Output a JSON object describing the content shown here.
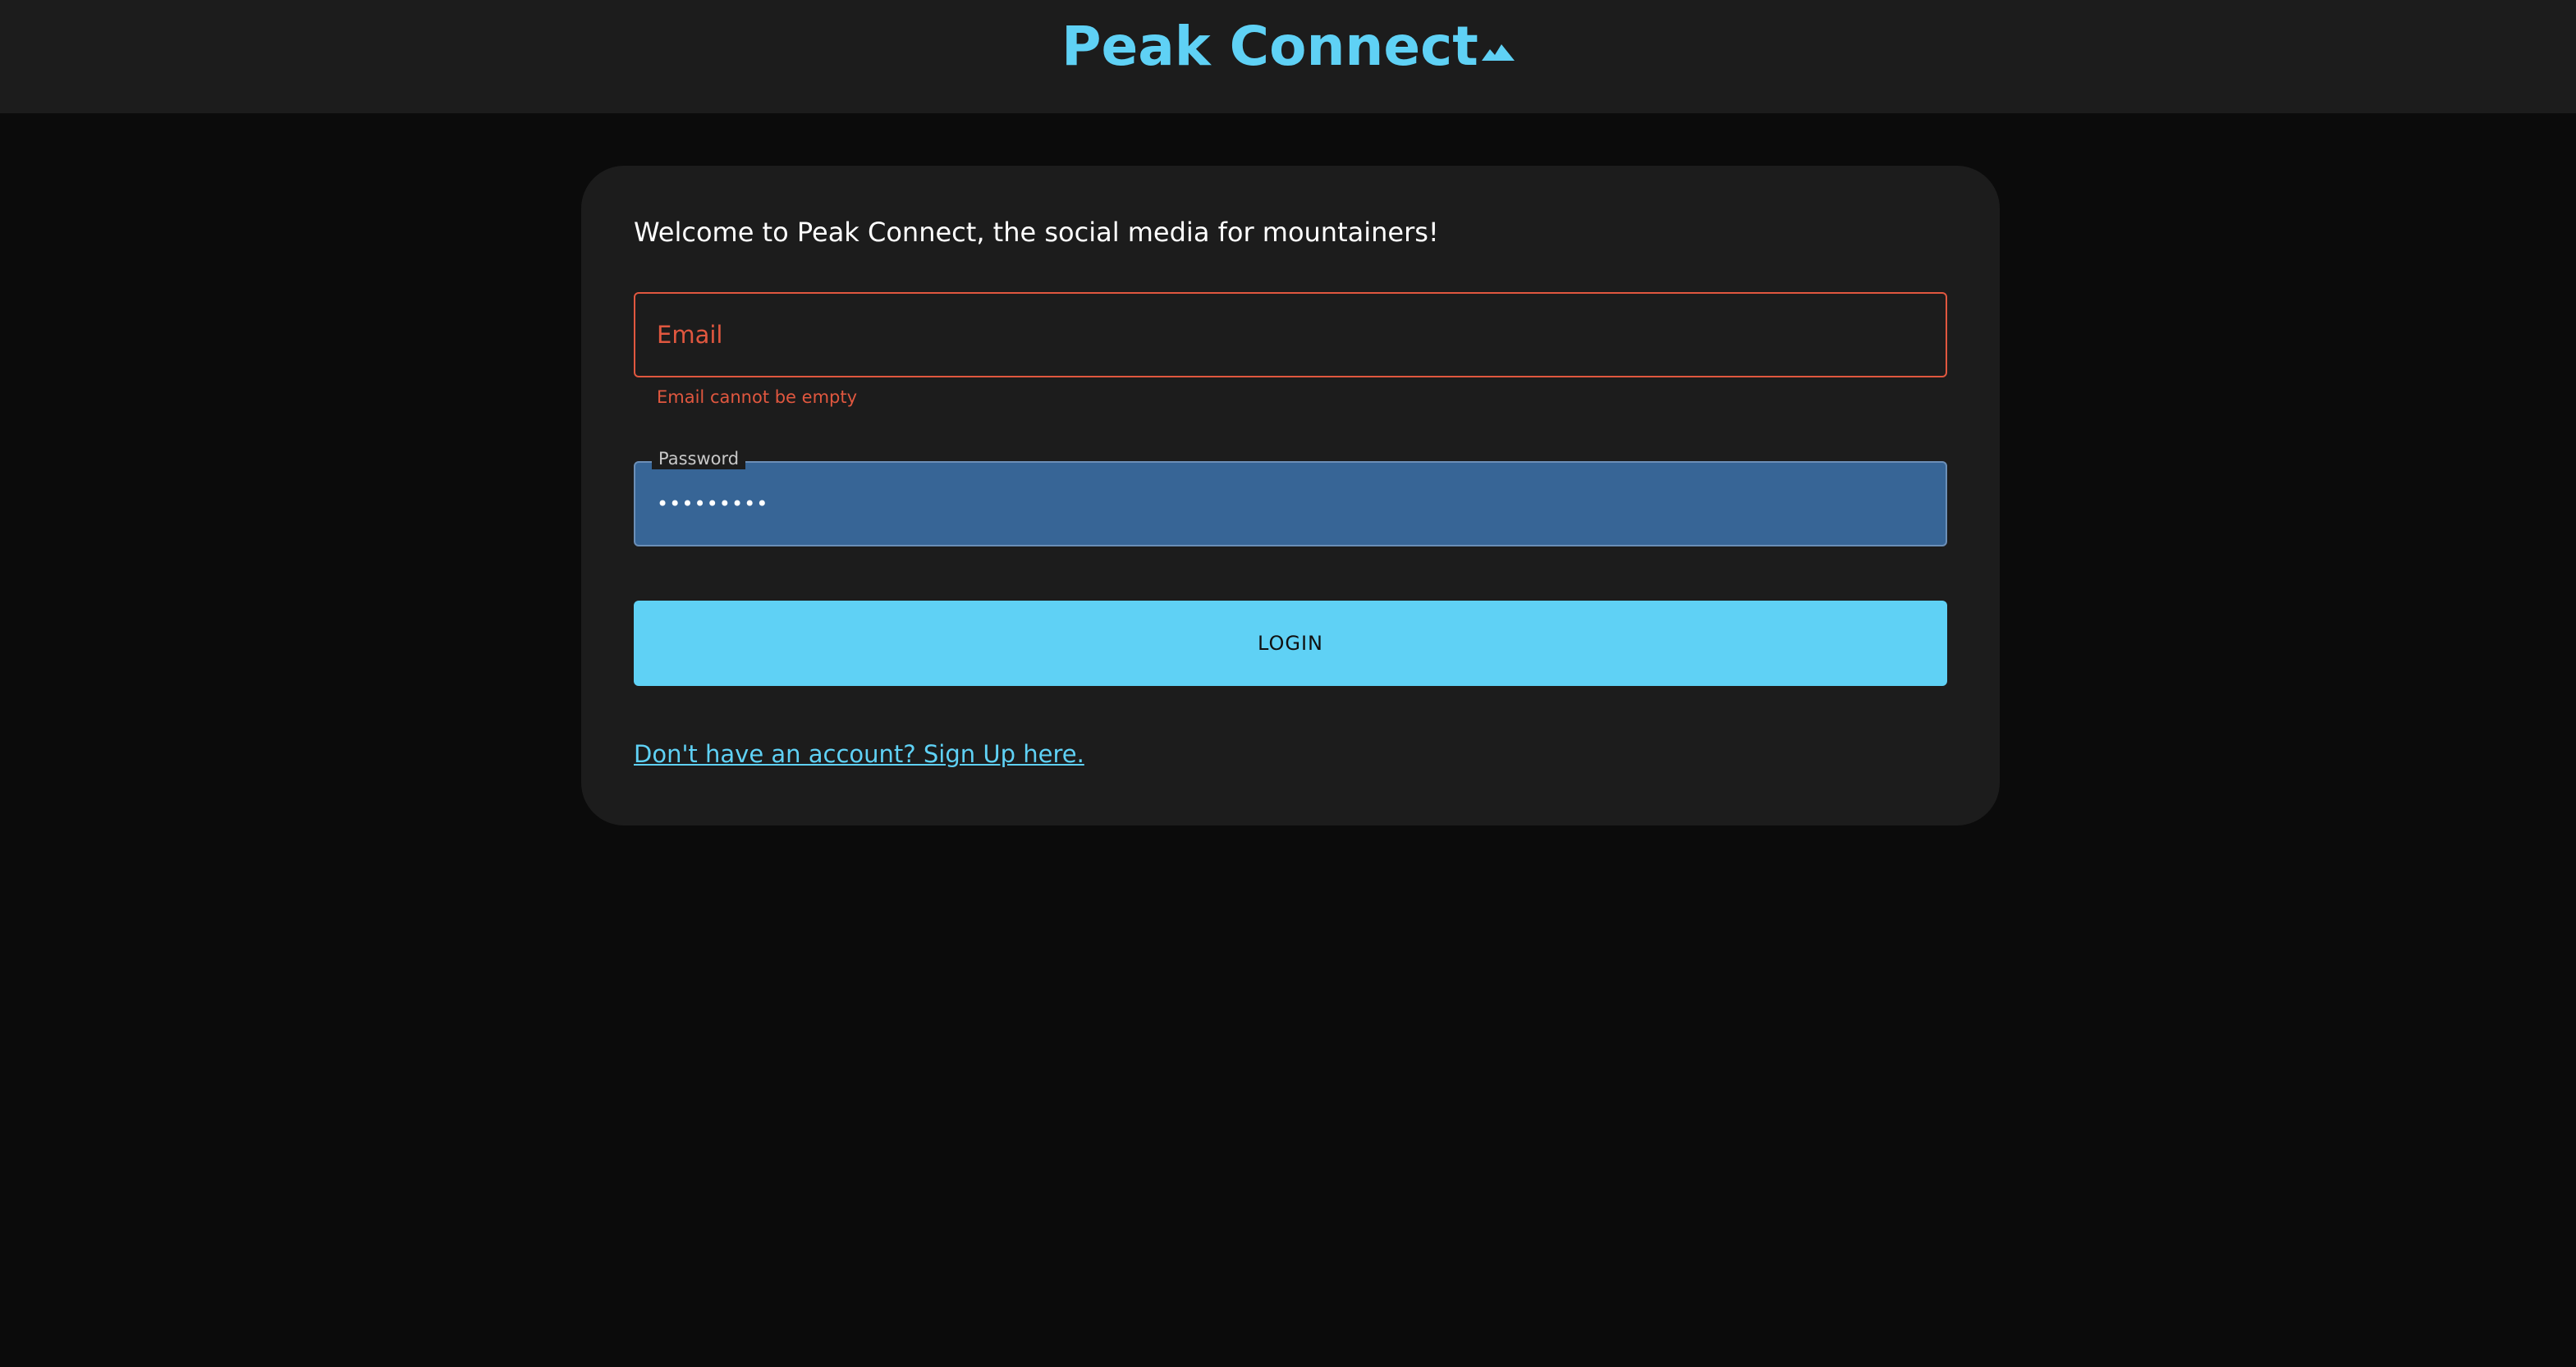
{
  "header": {
    "title": "Peak Connect",
    "icon": "mountain-icon",
    "accent_color": "#5fd1f5"
  },
  "login_card": {
    "welcome_text": "Welcome to Peak Connect, the social media for mountainers!",
    "email": {
      "placeholder": "Email",
      "value": "",
      "error": "Email cannot be empty",
      "error_color": "#e0573f"
    },
    "password": {
      "label": "Password",
      "value": "•••••••••"
    },
    "login_button_label": "LOGIN",
    "signup_link_text": "Don't have an account? Sign Up here."
  }
}
